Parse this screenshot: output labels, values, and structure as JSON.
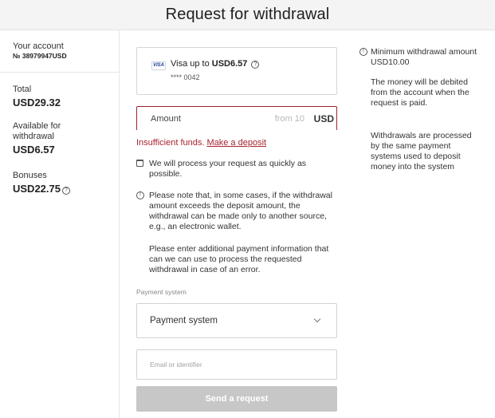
{
  "header": {
    "title": "Request for withdrawal"
  },
  "account": {
    "label": "Your account",
    "number": "№ 38979947USD"
  },
  "stats": {
    "total": {
      "label": "Total",
      "value": "USD29.32"
    },
    "available": {
      "label": "Available for withdrawal",
      "value": "USD6.57"
    },
    "bonuses": {
      "label": "Bonuses",
      "value": "USD22.75"
    }
  },
  "card": {
    "logo": "VISA",
    "title_prefix": "Visa up to ",
    "title_amount": "USD6.57",
    "masked_number": "**** 0042"
  },
  "amount": {
    "label": "Amount",
    "hint": "from 10",
    "currency": "USD"
  },
  "error": {
    "text": "Insufficient funds.",
    "link": "Make a deposit"
  },
  "notes": {
    "speed": "We will process your request as quickly as possible.",
    "warning": "Please note that, in some cases, if the withdrawal amount exceeds the deposit amount, the withdrawal can be made only to another source, e.g., an electronic wallet.",
    "additional": "Please enter additional payment information that can we can use to process the requested withdrawal in case of an error."
  },
  "payment_system": {
    "label": "Payment system",
    "selected": "Payment system"
  },
  "email": {
    "placeholder": "Email or identifier",
    "value": ""
  },
  "submit": {
    "label": "Send a request"
  },
  "info": {
    "minimum": "Minimum withdrawal amount USD10.00",
    "debit": "The money will be debited from the account when the request is paid.",
    "processing": "Withdrawals are processed by the same payment systems used to deposit money into the system"
  },
  "colors": {
    "error": "#a8232f",
    "button_disabled": "#c7c7c7",
    "header_bg": "#f4f4f4"
  },
  "icons": {
    "info": "info-circle-icon",
    "calendar": "calendar-icon",
    "chevron": "chevron-down-icon"
  }
}
